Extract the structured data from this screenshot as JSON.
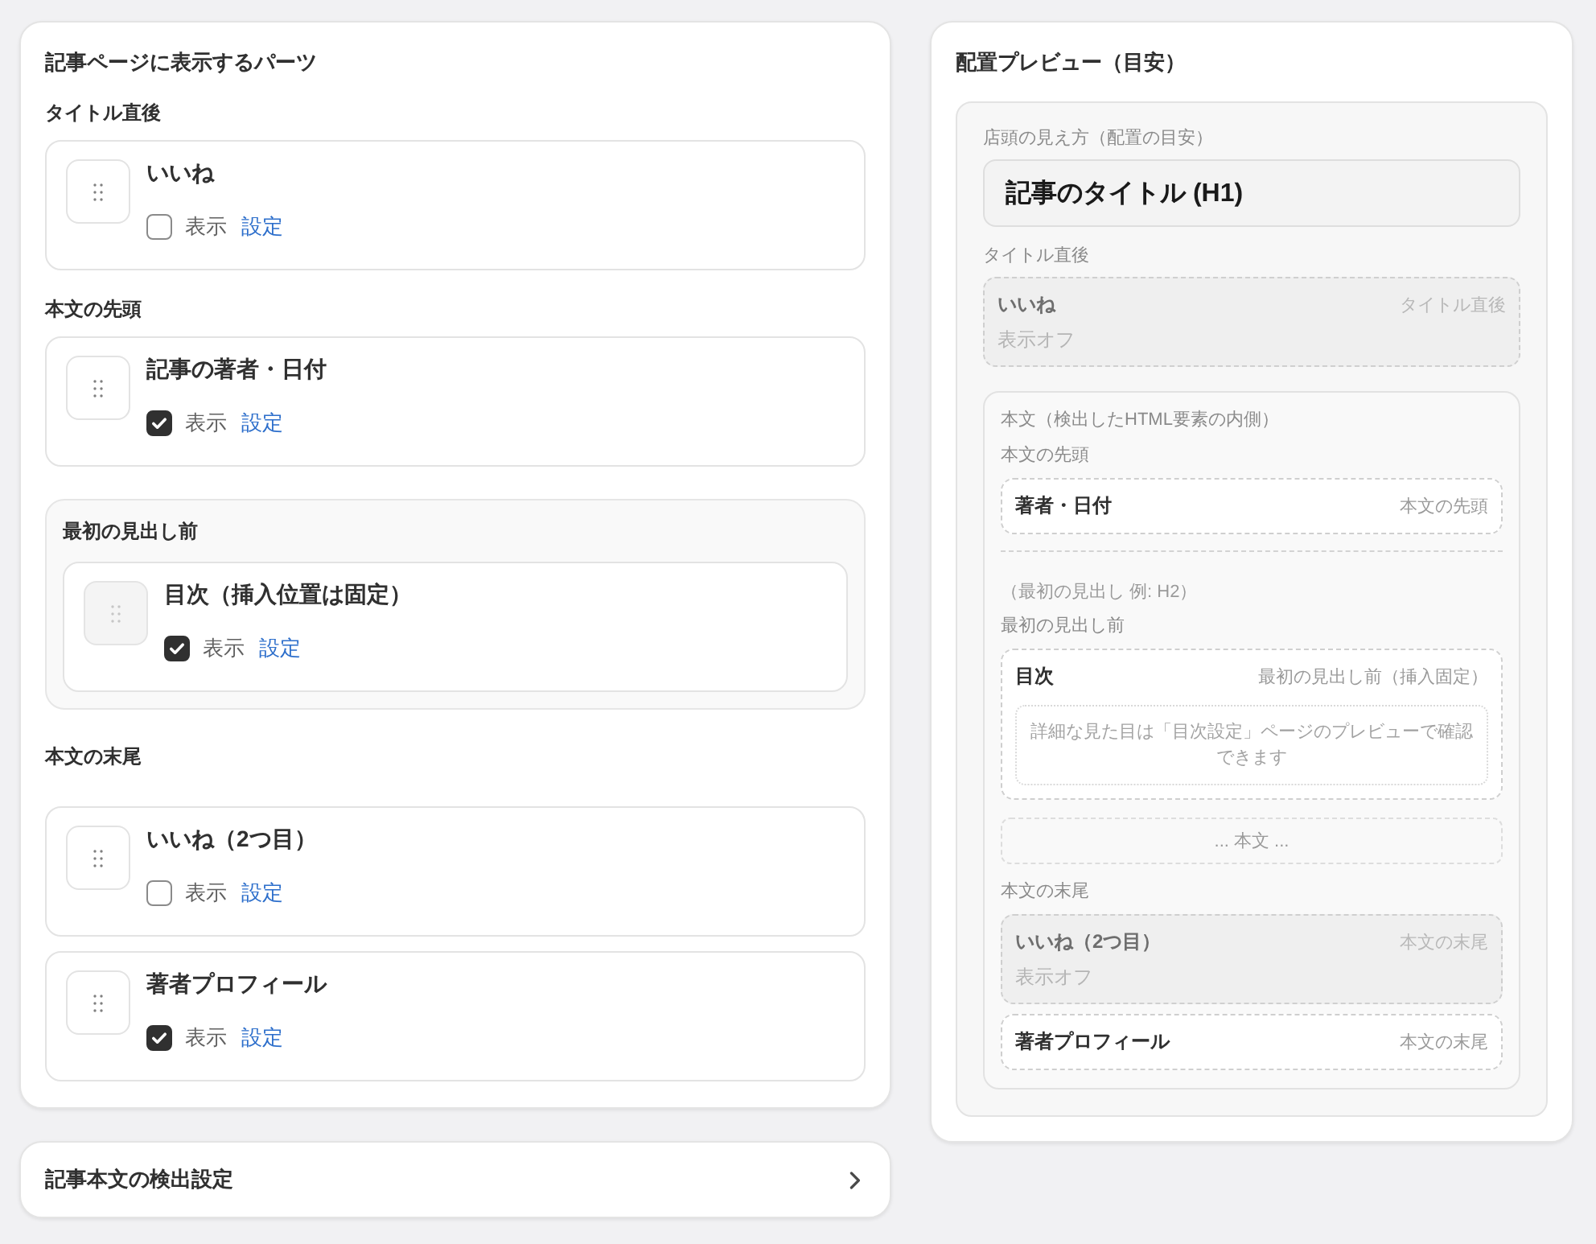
{
  "parts_panel": {
    "title": "記事ページに表示するパーツ",
    "sections": [
      {
        "kind": "plain",
        "label": "タイトル直後",
        "items": [
          {
            "name": "いいね",
            "draggable": true,
            "checked": false,
            "checkbox_label": "表示",
            "link": "設定"
          }
        ]
      },
      {
        "kind": "plain",
        "label": "本文の先頭",
        "items": [
          {
            "name": "記事の著者・日付",
            "draggable": true,
            "checked": true,
            "checkbox_label": "表示",
            "link": "設定"
          }
        ]
      },
      {
        "kind": "group",
        "label": "最初の見出し前",
        "items": [
          {
            "name": "目次（挿入位置は固定）",
            "draggable": false,
            "checked": true,
            "checkbox_label": "表示",
            "link": "設定"
          }
        ]
      },
      {
        "kind": "plain",
        "label": "本文の末尾",
        "items": [
          {
            "name": "いいね（2つ目）",
            "draggable": true,
            "checked": false,
            "checkbox_label": "表示",
            "link": "設定"
          },
          {
            "name": "著者プロフィール",
            "draggable": true,
            "checked": true,
            "checkbox_label": "表示",
            "link": "設定"
          }
        ]
      }
    ]
  },
  "detection_settings": {
    "title": "記事本文の検出設定"
  },
  "preview": {
    "title": "配置プレビュー（目安）",
    "caption": "店頭の見え方（配置の目安）",
    "heading": "記事のタイトル (H1)",
    "title_area": {
      "label": "タイトル直後",
      "parts": [
        {
          "name": "いいね",
          "position": "タイトル直後",
          "on": false,
          "status": "表示オフ"
        }
      ]
    },
    "body": {
      "label": "本文（検出したHTML要素の内側）",
      "blocks": [
        {
          "kind": "label",
          "text": "本文の先頭"
        },
        {
          "kind": "part",
          "name": "著者・日付",
          "position": "本文の先頭",
          "on": true
        },
        {
          "kind": "divider"
        },
        {
          "kind": "note",
          "text": "（最初の見出し 例: H2）"
        },
        {
          "kind": "label",
          "text": "最初の見出し前"
        },
        {
          "kind": "part",
          "name": "目次",
          "position": "最初の見出し前（挿入固定）",
          "on": true,
          "note": "詳細な見た目は「目次設定」ページのプレビューで確認できます"
        },
        {
          "kind": "filler",
          "text": "... 本文 ..."
        },
        {
          "kind": "label",
          "text": "本文の末尾"
        },
        {
          "kind": "part",
          "name": "いいね（2つ目）",
          "position": "本文の末尾",
          "on": false,
          "status": "表示オフ"
        },
        {
          "kind": "part",
          "name": "著者プロフィール",
          "position": "本文の末尾",
          "on": true
        }
      ]
    }
  }
}
